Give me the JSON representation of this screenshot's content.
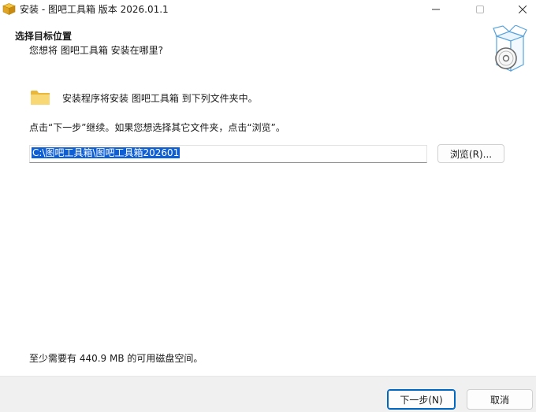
{
  "window": {
    "title": "安装 - 图吧工具箱 版本 2026.01.1",
    "icon": "installer-box-icon"
  },
  "header": {
    "title": "选择目标位置",
    "subtitle": "您想将 图吧工具箱 安装在哪里?",
    "icon": "box-with-disc-icon"
  },
  "content": {
    "intro": "安装程序将安装 图吧工具箱 到下列文件夹中。",
    "instruction": "点击“下一步”继续。如果您想选择其它文件夹，点击“浏览”。",
    "install_path": "C:\\图吧工具箱\\图吧工具箱202601",
    "browse_label": "浏览(R)...",
    "disk_space": "至少需要有 440.9 MB 的可用磁盘空间。"
  },
  "footer": {
    "next_label": "下一步(N)",
    "cancel_label": "取消"
  },
  "colors": {
    "selection": "#0f5fd4",
    "default_button_border": "#0067c0",
    "footer_bg": "#f0f0f0"
  }
}
